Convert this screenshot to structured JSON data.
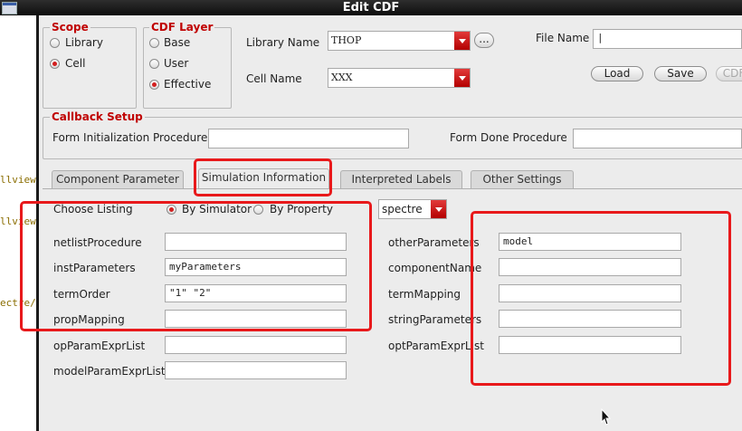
{
  "window": {
    "title": "Edit CDF"
  },
  "background_fragments": [
    "llview",
    "llview",
    "ectre/"
  ],
  "scope": {
    "title": "Scope",
    "options": [
      {
        "label": "Library",
        "selected": false
      },
      {
        "label": "Cell",
        "selected": true
      }
    ]
  },
  "cdf_layer": {
    "title": "CDF Layer",
    "options": [
      {
        "label": "Base",
        "selected": false
      },
      {
        "label": "User",
        "selected": false
      },
      {
        "label": "Effective",
        "selected": true
      }
    ]
  },
  "library": {
    "label": "Library Name",
    "value": "THOP",
    "browse_label": "..."
  },
  "cell": {
    "label": "Cell Name",
    "value": "XXX"
  },
  "file": {
    "label": "File Name",
    "value": "|"
  },
  "buttons": {
    "load": "Load",
    "save": "Save",
    "cdf": "CDF"
  },
  "callback": {
    "title": "Callback Setup",
    "init_label": "Form Initialization Procedure",
    "init_value": "",
    "done_label": "Form Done Procedure",
    "done_value": ""
  },
  "tabs": [
    "Component Parameter",
    "Simulation Information",
    "Interpreted Labels",
    "Other Settings"
  ],
  "active_tab": "Simulation Information",
  "listing": {
    "label": "Choose Listing",
    "by_simulator": "By Simulator",
    "by_property": "By Property",
    "selected": "By Simulator",
    "simulator": "spectre"
  },
  "left_params": [
    {
      "label": "netlistProcedure",
      "value": ""
    },
    {
      "label": "instParameters",
      "value": "myParameters"
    },
    {
      "label": "termOrder",
      "value": "\"1\" \"2\""
    },
    {
      "label": "propMapping",
      "value": ""
    },
    {
      "label": "opParamExprList",
      "value": ""
    },
    {
      "label": "modelParamExprList",
      "value": ""
    }
  ],
  "right_params": [
    {
      "label": "otherParameters",
      "value": "model"
    },
    {
      "label": "componentName",
      "value": ""
    },
    {
      "label": "termMapping",
      "value": ""
    },
    {
      "label": "stringParameters",
      "value": ""
    },
    {
      "label": "optParamExprList",
      "value": ""
    }
  ],
  "colors": {
    "highlight": "#e8191b",
    "group_title": "#c00000",
    "combo_arrow": "#c81414"
  }
}
